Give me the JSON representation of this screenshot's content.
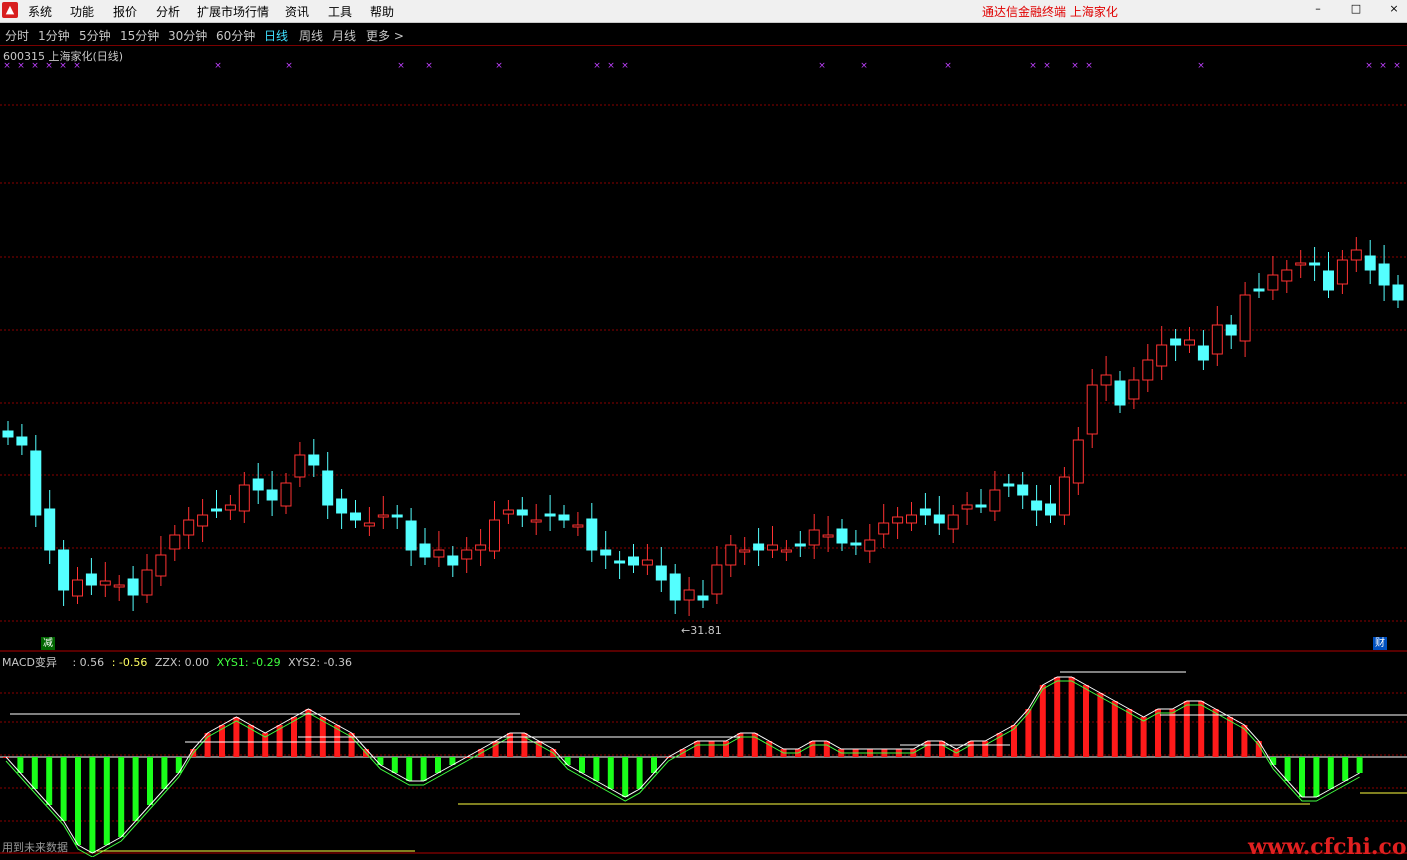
{
  "menubar": {
    "items": [
      "系统",
      "功能",
      "报价",
      "分析",
      "扩展市场行情",
      "资讯",
      "工具",
      "帮助"
    ],
    "title": "通达信金融终端   上海家化",
    "logo": "app-logo-icon"
  },
  "periods": [
    "分时",
    "1分钟",
    "5分钟",
    "15分钟",
    "30分钟",
    "60分钟",
    "日线",
    "周线",
    "月线",
    "更多 >"
  ],
  "active_period": "日线",
  "stock": {
    "title": "600315 上海家化(日线)"
  },
  "low_price_label": "31.81",
  "badges": {
    "left": "减",
    "right": "财"
  },
  "macd_legend": {
    "name": "MACD变异",
    "v1": ": 0.56",
    "v2": ": -0.56",
    "zzx": "ZZX: 0.00",
    "xys1": "XYS1: -0.29",
    "xys2": "XYS2: -0.36"
  },
  "future_note": "用到未来数据",
  "watermark": "www.cfchi.com",
  "colors": {
    "up": "#ff3232",
    "down": "#54ffff",
    "macd_up": "#ff1a1a",
    "macd_down": "#1aff1a",
    "grid": "#8a0000",
    "marker": "#c040ff"
  },
  "chart_data": {
    "type": "candlestick",
    "title": "600315 上海家化(日线)",
    "marked_low": 31.81,
    "candles": [
      [
        2,
        0,
        0,
        0
      ],
      [
        0,
        -1,
        -1,
        -1
      ],
      [
        1,
        0,
        0,
        0
      ],
      [
        0,
        0,
        0,
        0
      ],
      [
        0,
        0,
        0,
        0
      ]
    ],
    "macd": [
      0,
      -2,
      -4,
      -6,
      -8,
      -11,
      -12,
      -11,
      -10,
      -8,
      -6,
      -4,
      -2,
      1,
      3,
      4,
      5,
      4,
      3,
      4,
      5,
      6,
      5,
      4,
      3,
      1,
      -1,
      -2,
      -3,
      -3,
      -2,
      -1,
      0,
      1,
      2,
      3,
      3,
      2,
      1,
      -1,
      -2,
      -3,
      -4,
      -5,
      -4,
      -2,
      0,
      1,
      2,
      2,
      2,
      3,
      3,
      2,
      1,
      1,
      2,
      2,
      1,
      1,
      1,
      1,
      1,
      1,
      2,
      2,
      1,
      2,
      2,
      3,
      4,
      6,
      9,
      10,
      10,
      9,
      8,
      7,
      6,
      5,
      6,
      6,
      7,
      7,
      6,
      5,
      4,
      2,
      -1,
      -3,
      -5,
      -5,
      -4,
      -3,
      -2
    ]
  }
}
